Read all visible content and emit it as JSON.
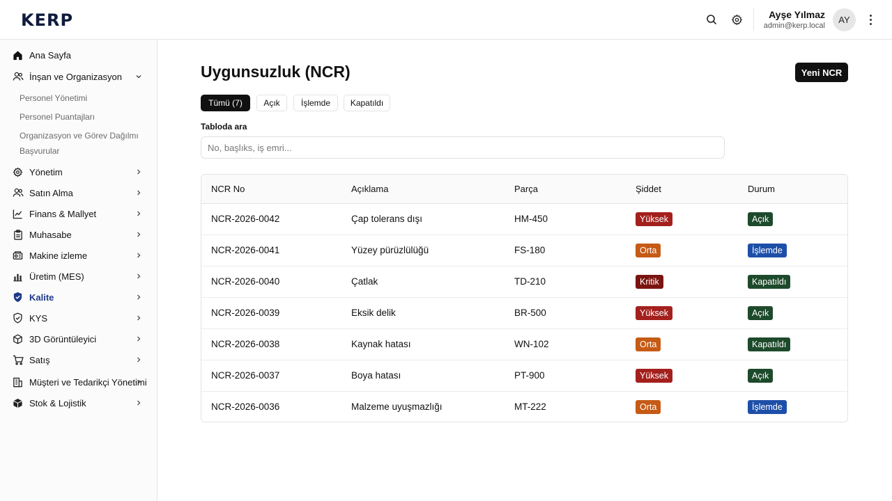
{
  "app": {
    "logo": "KERP"
  },
  "header": {
    "user_name": "Ayşe Yılmaz",
    "user_email": "admin@kerp.local",
    "avatar_initials": "AY",
    "icons": [
      "search-icon",
      "gear-icon",
      "more-vertical-icon"
    ]
  },
  "sidebar": {
    "items": [
      {
        "label": "Ana Sayfa",
        "icon": "home-icon"
      },
      {
        "label": "İnşan ve Organizasyon",
        "icon": "users-icon",
        "expanded": true
      },
      {
        "label": "Yönetim",
        "icon": "gear-icon"
      },
      {
        "label": "Satın Alma",
        "icon": "users-icon"
      },
      {
        "label": "Finans & Mallyet",
        "icon": "chart-line-icon"
      },
      {
        "label": "Muhasabe",
        "icon": "clipboard-icon"
      },
      {
        "label": "Makine izleme",
        "icon": "machine-icon"
      },
      {
        "label": "Üretim (MES)",
        "icon": "bar-chart-icon"
      },
      {
        "label": "Kalite",
        "icon": "shield-icon",
        "active": true
      },
      {
        "label": "KYS",
        "icon": "shield-outline-icon"
      },
      {
        "label": "3D Görüntüleyici",
        "icon": "cube-icon"
      },
      {
        "label": "Satış",
        "icon": "cart-icon"
      },
      {
        "label": "Müşteri ve Tedarikçi Yönetimi",
        "icon": "building-icon"
      },
      {
        "label": "Stok & Lojistik",
        "icon": "box-icon"
      }
    ],
    "sub_items": [
      "Personel Yönetimi",
      "Personel Puantajları",
      "Organizasyon ve Görev Dağılmı",
      "Başvurular"
    ]
  },
  "main": {
    "title": "Uygunsuzluk (NCR)",
    "new_button": "Yeni NCR",
    "tabs": [
      {
        "label": "Tümü (7)",
        "active": true
      },
      {
        "label": "Açık",
        "active": false
      },
      {
        "label": "İşlemde",
        "active": false
      },
      {
        "label": "Kapatıldı",
        "active": false
      }
    ],
    "search_label": "Tabloda ara",
    "search_placeholder": "No, başlıks, iş emri...",
    "search_value": ""
  },
  "table": {
    "columns": [
      "NCR No",
      "Açıklama",
      "Parça",
      "Şiddet",
      "Durum"
    ],
    "rows": [
      {
        "no": "NCR-2026-0042",
        "desc": "Çap tolerans dışı",
        "part": "HM-450",
        "severity": "Yüksek",
        "status": "Açık"
      },
      {
        "no": "NCR-2026-0041",
        "desc": "Yüzey pürüzlülüğü",
        "part": "FS-180",
        "severity": "Orta",
        "status": "İşlemde"
      },
      {
        "no": "NCR-2026-0040",
        "desc": "Çatlak",
        "part": "TD-210",
        "severity": "Kritik",
        "status": "Kapatıldı"
      },
      {
        "no": "NCR-2026-0039",
        "desc": "Eksik delik",
        "part": "BR-500",
        "severity": "Yüksek",
        "status": "Açık"
      },
      {
        "no": "NCR-2026-0038",
        "desc": "Kaynak hatası",
        "part": "WN-102",
        "severity": "Orta",
        "status": "Kapatıldı"
      },
      {
        "no": "NCR-2026-0037",
        "desc": "Boya hatası",
        "part": "PT-900",
        "severity": "Yüksek",
        "status": "Açık"
      },
      {
        "no": "NCR-2026-0036",
        "desc": "Malzeme uyuşmazlığı",
        "part": "MT-222",
        "severity": "Orta",
        "status": "İşlemde"
      }
    ]
  },
  "colors": {
    "severity": {
      "Yüksek": "#a3201d",
      "Orta": "#c65b16",
      "Kritik": "#7a1410"
    },
    "status": {
      "Açık": "#1d4a2b",
      "İşlemde": "#1e4fa8",
      "Kapatıldı": "#1d4a2b"
    },
    "accent": "#1f3a8a"
  }
}
